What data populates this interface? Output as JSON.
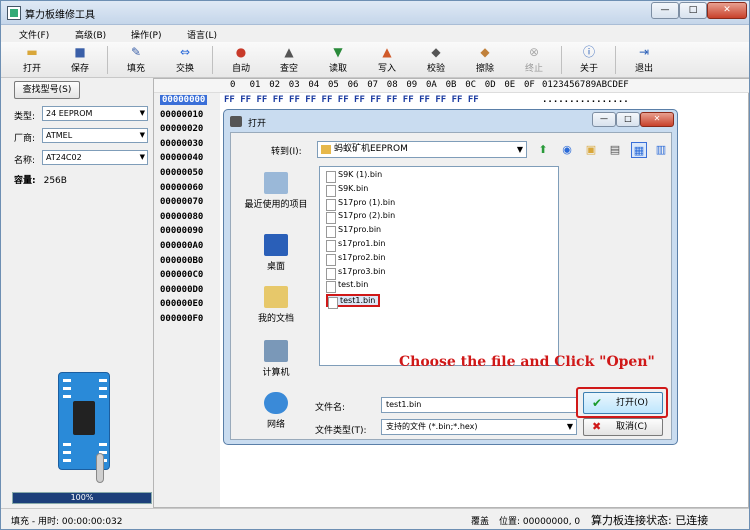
{
  "app": {
    "title": "算力板维修工具"
  },
  "window_controls": {
    "min": "—",
    "max": "□",
    "close": "✕"
  },
  "menu": [
    "文件(F)",
    "高级(B)",
    "操作(P)",
    "语言(L)"
  ],
  "toolbar": [
    {
      "label": "打开",
      "icon": "folder-open-icon"
    },
    {
      "label": "保存",
      "icon": "save-icon"
    },
    {
      "label": "填充",
      "icon": "fill-icon"
    },
    {
      "label": "交换",
      "icon": "swap-icon"
    },
    {
      "label": "自动",
      "icon": "auto-icon"
    },
    {
      "label": "查空",
      "icon": "blank-check-icon"
    },
    {
      "label": "读取",
      "icon": "read-icon"
    },
    {
      "label": "写入",
      "icon": "write-icon"
    },
    {
      "label": "校验",
      "icon": "verify-icon"
    },
    {
      "label": "擦除",
      "icon": "erase-icon"
    },
    {
      "label": "终止",
      "icon": "stop-icon"
    },
    {
      "label": "关于",
      "icon": "info-icon"
    },
    {
      "label": "退出",
      "icon": "exit-icon"
    }
  ],
  "sidebar": {
    "lookup_button": "查找型号(S)",
    "type_label": "类型:",
    "type_value": "24 EEPROM",
    "vendor_label": "厂商:",
    "vendor_value": "ATMEL",
    "name_label": "名称:",
    "name_value": "AT24C02",
    "capacity_label": "容量:",
    "capacity_value": "256B",
    "progress": "100%"
  },
  "hex": {
    "header_cols": [
      "0",
      "01",
      "02",
      "03",
      "04",
      "05",
      "06",
      "07",
      "08",
      "09",
      "0A",
      "0B",
      "0C",
      "0D",
      "0E",
      "0F"
    ],
    "header_ascii": "0123456789ABCDEF",
    "addresses": [
      "00000000",
      "00000010",
      "00000020",
      "00000030",
      "00000040",
      "00000050",
      "00000060",
      "00000070",
      "00000080",
      "00000090",
      "000000A0",
      "000000B0",
      "000000C0",
      "000000D0",
      "000000E0",
      "000000F0"
    ],
    "first_row": "FF FF FF FF FF FF FF FF FF FF FF FF FF FF FF FF",
    "first_ascii": "................"
  },
  "dialog": {
    "title": "打开",
    "lookin_label": "转到(I):",
    "lookin_value": "蚂蚁矿机EEPROM",
    "places": [
      "最近使用的项目",
      "桌面",
      "我的文档",
      "计算机",
      "网络"
    ],
    "files": [
      "S9K (1).bin",
      "S9K.bin",
      "S17pro (1).bin",
      "S17pro (2).bin",
      "S17pro.bin",
      "s17pro1.bin",
      "s17pro2.bin",
      "s17pro3.bin",
      "test.bin",
      "test1.bin"
    ],
    "filename_label": "文件名:",
    "filename_value": "test1.bin",
    "filetype_label": "文件类型(T):",
    "filetype_value": "支持的文件 (*.bin;*.hex)",
    "open_button": "打开(O)",
    "cancel_button": "取消(C)"
  },
  "annotation": "Choose the file and Click \"Open\"",
  "status": {
    "left": "填充 - 用时: 00:00:00:032",
    "mode": "覆盖",
    "position": "位置: 00000000, 0",
    "connection": "算力板连接状态: 已连接"
  },
  "colors": {
    "accent": "#d01818",
    "hex_text": "#1a3aa0",
    "selection": "#3a6fd8"
  }
}
